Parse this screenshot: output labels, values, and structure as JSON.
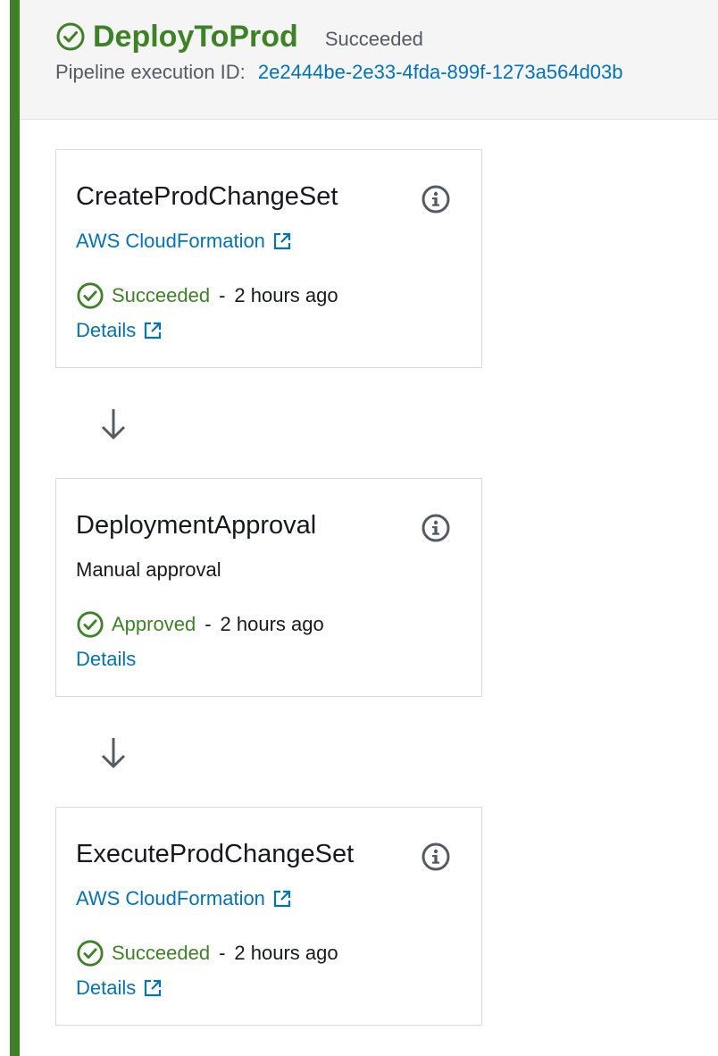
{
  "stage": {
    "title": "DeployToProd",
    "status": "Succeeded",
    "execution_label": "Pipeline execution ID:",
    "execution_id": "2e2444be-2e33-4fda-899f-1273a564d03b"
  },
  "actions": [
    {
      "name": "CreateProdChangeSet",
      "provider": "AWS CloudFormation",
      "status": "Succeeded",
      "separator": "-",
      "time": "2 hours ago",
      "details": "Details"
    },
    {
      "name": "DeploymentApproval",
      "provider": "Manual approval",
      "status": "Approved",
      "separator": "-",
      "time": "2 hours ago",
      "details": "Details"
    },
    {
      "name": "ExecuteProdChangeSet",
      "provider": "AWS CloudFormation",
      "status": "Succeeded",
      "separator": "-",
      "time": "2 hours ago",
      "details": "Details"
    }
  ],
  "colors": {
    "success": "#3d8225",
    "link": "#0073bb",
    "muted": "#545b64"
  },
  "icons": [
    "check-circle-icon",
    "info-icon",
    "external-link-icon",
    "arrow-down-icon"
  ]
}
